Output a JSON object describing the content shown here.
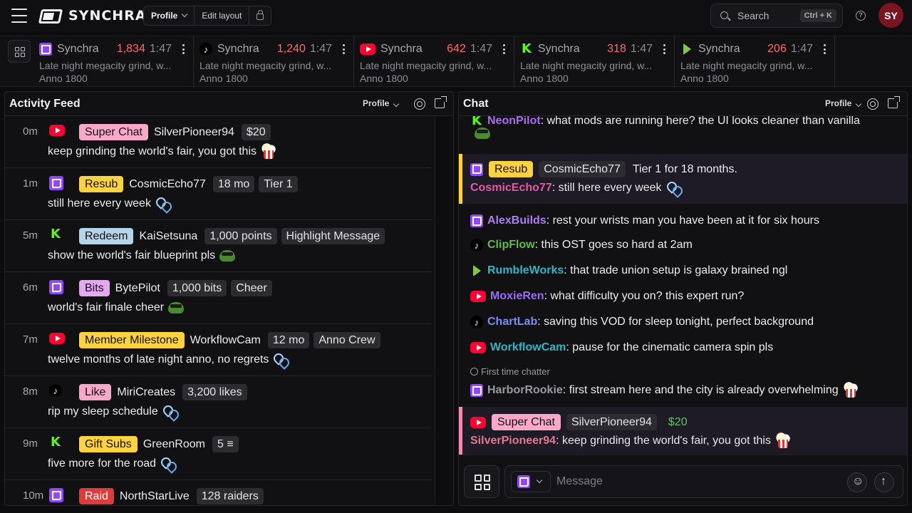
{
  "app": {
    "name": "SYNCHRA",
    "avatar_initials": "SY"
  },
  "toolbar": {
    "profile_label": "Profile",
    "edit_label": "Edit layout"
  },
  "search": {
    "placeholder": "Search",
    "shortcut": "Ctrl + K"
  },
  "streams": [
    {
      "platform": "twitch",
      "name": "Synchra",
      "viewers": "1,834",
      "time": "1:47",
      "title": "Late night megacity grind, w...",
      "game": "Anno 1800"
    },
    {
      "platform": "tiktok",
      "name": "Synchra",
      "viewers": "1,240",
      "time": "1:47",
      "title": "Late night megacity grind, w...",
      "game": "Anno 1800"
    },
    {
      "platform": "youtube",
      "name": "Synchra",
      "viewers": "642",
      "time": "1:47",
      "title": "Late night megacity grind, w...",
      "game": "Anno 1800"
    },
    {
      "platform": "kick",
      "name": "Synchra",
      "viewers": "318",
      "time": "1:47",
      "title": "Late night megacity grind, w...",
      "game": "Anno 1800"
    },
    {
      "platform": "rumble",
      "name": "Synchra",
      "viewers": "206",
      "time": "1:47",
      "title": "Late night megacity grind, w...",
      "game": "Anno 1800"
    }
  ],
  "activity": {
    "title": "Activity Feed",
    "profile_label": "Profile",
    "items": [
      {
        "time": "0m",
        "platform": "youtube",
        "type": "Super Chat",
        "badge_color": "#f9a8c9",
        "user": "SilverPioneer94",
        "pills": [
          "$20"
        ],
        "message": "keep grinding the world's fair, you got this",
        "emote": "popcorn"
      },
      {
        "time": "1m",
        "platform": "twitch",
        "type": "Resub",
        "badge_color": "#ffd23f",
        "user": "CosmicEcho77",
        "pills": [
          "18 mo",
          "Tier 1"
        ],
        "message": "still here every week",
        "emote": "hearts"
      },
      {
        "time": "5m",
        "platform": "kick",
        "type": "Redeem",
        "badge_color": "#b7d3e8",
        "user": "KaiSetsuna",
        "pills": [
          "1,000 points",
          "Highlight Message"
        ],
        "message": "show the world's fair blueprint pls",
        "emote": "frog"
      },
      {
        "time": "6m",
        "platform": "twitch",
        "type": "Bits",
        "badge_color": "#e6a8f5",
        "user": "BytePilot",
        "pills": [
          "1,000 bits",
          "Cheer"
        ],
        "message": "world's fair finale cheer",
        "emote": "frog"
      },
      {
        "time": "7m",
        "platform": "youtube",
        "type": "Member Milestone",
        "badge_color": "#ffd23f",
        "user": "WorkflowCam",
        "pills": [
          "12 mo",
          "Anno Crew"
        ],
        "message": "twelve months of late night anno, no regrets",
        "emote": "hearts"
      },
      {
        "time": "8m",
        "platform": "tiktok",
        "type": "Like",
        "badge_color": "#f9a8c9",
        "user": "MiriCreates",
        "pills": [
          "3,200 likes"
        ],
        "message": "rip my sleep schedule",
        "emote": "hearts"
      },
      {
        "time": "9m",
        "platform": "kick",
        "type": "Gift Subs",
        "badge_color": "#ffd23f",
        "user": "GreenRoom",
        "pills": [
          "5 ≡"
        ],
        "message": "five more for the road",
        "emote": "hearts"
      },
      {
        "time": "10m",
        "platform": "twitch",
        "type": "Raid",
        "badge_color": "#e03a3a",
        "user": "NorthStarLive",
        "pills": [
          "128 raiders"
        ],
        "message": "",
        "emote": ""
      }
    ]
  },
  "chat": {
    "title": "Chat",
    "profile_label": "Profile",
    "first_time_label": "First time chatter",
    "message_placeholder": "Message",
    "messages": [
      {
        "platform": "kick",
        "user": "NeonPilot",
        "color": "#a86cf0",
        "text": ": what mods are running here? the UI looks cleaner than vanilla"
      },
      {
        "platform": "twitch",
        "user": "AlexBuilds",
        "color": "#b07cf5",
        "text": ": rest your wrists man you have been at it for six hours"
      },
      {
        "platform": "tiktok",
        "user": "ClipFlow",
        "color": "#62b84a",
        "text": ": this OST goes so hard at 2am"
      },
      {
        "platform": "rumble",
        "user": "RumbleWorks",
        "color": "#2fb5c6",
        "text": ": that trade union setup is galaxy brained ngl"
      },
      {
        "platform": "youtube",
        "user": "MoxieRen",
        "color": "#9a6cf5",
        "text": ": what difficulty you on? this expert run?"
      },
      {
        "platform": "tiktok",
        "user": "ChartLab",
        "color": "#7c8cf5",
        "text": ": saving this VOD for sleep tonight, perfect background"
      },
      {
        "platform": "youtube",
        "user": "WorkflowCam",
        "color": "#2fb5c6",
        "text": ": pause for the cinematic camera spin pls"
      },
      {
        "platform": "twitch",
        "user": "HarborRookie",
        "color": "#9a9a9f",
        "text": ": first stream here and the city is already overwhelming"
      }
    ],
    "highlights": [
      {
        "platform": "twitch",
        "type": "Resub",
        "badge_color": "#ffd23f",
        "border_color": "#ffd23f",
        "user_pill": "CosmicEcho77",
        "extra": "Tier 1 for 18 months.",
        "user": "CosmicEcho77",
        "color": "#e05aa8",
        "text": ": still here every week"
      },
      {
        "platform": "youtube",
        "type": "Super Chat",
        "badge_color": "#f9a8c9",
        "border_color": "#f08cb4",
        "user_pill": "SilverPioneer94",
        "extra": "$20",
        "user": "SilverPioneer94",
        "color": "#e07a8e",
        "text": ": keep grinding the world's fair, you got this"
      }
    ]
  }
}
